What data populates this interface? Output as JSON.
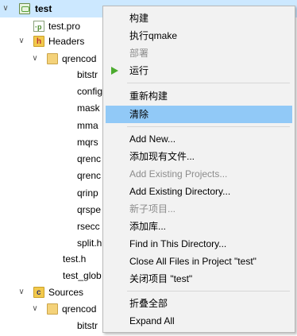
{
  "tree": {
    "rows": [
      {
        "arrow": "∨",
        "label": "test",
        "bold": true
      },
      {
        "label": "test.pro"
      },
      {
        "arrow": "∨",
        "label": "Headers"
      },
      {
        "arrow": "∨",
        "label": "qrencod"
      },
      {
        "label": "bitstr"
      },
      {
        "label": "config"
      },
      {
        "label": "mask"
      },
      {
        "label": "mma"
      },
      {
        "label": "mqrs"
      },
      {
        "label": "qrenc"
      },
      {
        "label": "qrenc"
      },
      {
        "label": "qrinp"
      },
      {
        "label": "qrspe"
      },
      {
        "label": "rsecc"
      },
      {
        "label": "split.h"
      },
      {
        "label": "test.h"
      },
      {
        "label": "test_glob"
      },
      {
        "arrow": "∨",
        "label": "Sources"
      },
      {
        "arrow": "∨",
        "label": "qrencod"
      },
      {
        "label": "bitstr"
      }
    ]
  },
  "menu": {
    "items": [
      {
        "label": "构建",
        "disabled": false
      },
      {
        "label": "执行qmake",
        "disabled": false
      },
      {
        "label": "部署",
        "disabled": true
      },
      {
        "label": "运行",
        "disabled": false,
        "icon": "run-icon"
      },
      {
        "label": "重新构建",
        "disabled": false
      },
      {
        "label": "清除",
        "disabled": false,
        "highlighted": true
      },
      {
        "label": "Add New...",
        "disabled": false
      },
      {
        "label": "添加现有文件...",
        "disabled": false
      },
      {
        "label": "Add Existing Projects...",
        "disabled": true
      },
      {
        "label": "Add Existing Directory...",
        "disabled": false
      },
      {
        "label": "新子项目...",
        "disabled": true
      },
      {
        "label": "添加库...",
        "disabled": false
      },
      {
        "label": "Find in This Directory...",
        "disabled": false
      },
      {
        "label": "Close All Files in Project \"test\"",
        "disabled": false
      },
      {
        "label": "关闭项目 \"test\"",
        "disabled": false
      },
      {
        "label": "折叠全部",
        "disabled": false
      },
      {
        "label": "Expand All",
        "disabled": false
      }
    ]
  },
  "colors": {
    "highlight": "#91c9f7",
    "selected_row": "#cce8ff",
    "run_icon": "#4cab2f",
    "disabled_text": "#8c8c8c"
  }
}
